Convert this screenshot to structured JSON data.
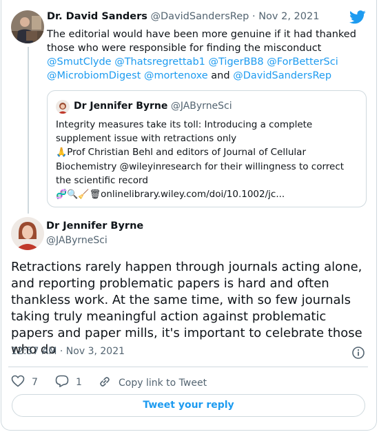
{
  "reply_tweet": {
    "author_name": "Dr. David Sanders",
    "author_handle": "@DavidSandersRep",
    "separator": "·",
    "date": "Nov 2, 2021",
    "text_intro": "The editorial would have been more genuine if it had thanked those who were responsible for finding the misconduct ",
    "mentions": [
      "@SmutClyde",
      "@Thatsregrettab1",
      "@TigerBB8",
      "@ForBetterSci",
      "@MicrobiomDigest",
      "@mortenoxe"
    ],
    "and_word": "and",
    "last_mention": "@DavidSandersRep"
  },
  "quoted_tweet": {
    "author_name": "Dr Jennifer Byrne",
    "author_handle": "@JAByrneSci",
    "line1": "Integrity measures take its toll: Introducing a complete supplement issue with retractions only",
    "line2": "Prof Christian Behl and editors of Journal of Cellular Biochemistry @wileyinresearch for their willingness to correct the scientific record",
    "link_text": "onlinelibrary.wiley.com/doi/10.1002/jc...",
    "emoji_icons": [
      "pray-icon",
      "dna-icon",
      "magnifier-icon",
      "broom-icon",
      "wastebasket-icon"
    ]
  },
  "main_tweet": {
    "author_name": "Dr Jennifer Byrne",
    "author_handle": "@JAByrneSci",
    "text": "Retractions rarely happen through journals acting alone, and reporting problematic papers is hard and often thankless work. At the same time, with so few journals taking truly meaningful action against problematic papers and paper mills, it's important to celebrate those who do",
    "timestamp": "12:57 AM · Nov 3, 2021"
  },
  "actions": {
    "like_count": "7",
    "reply_count": "1",
    "copy_link_label": "Copy link to Tweet"
  },
  "reply_button_label": "Tweet your reply",
  "colors": {
    "accent": "#1d9bf0",
    "text": "#0f1419",
    "muted": "#536471",
    "border": "#cfd9de"
  }
}
